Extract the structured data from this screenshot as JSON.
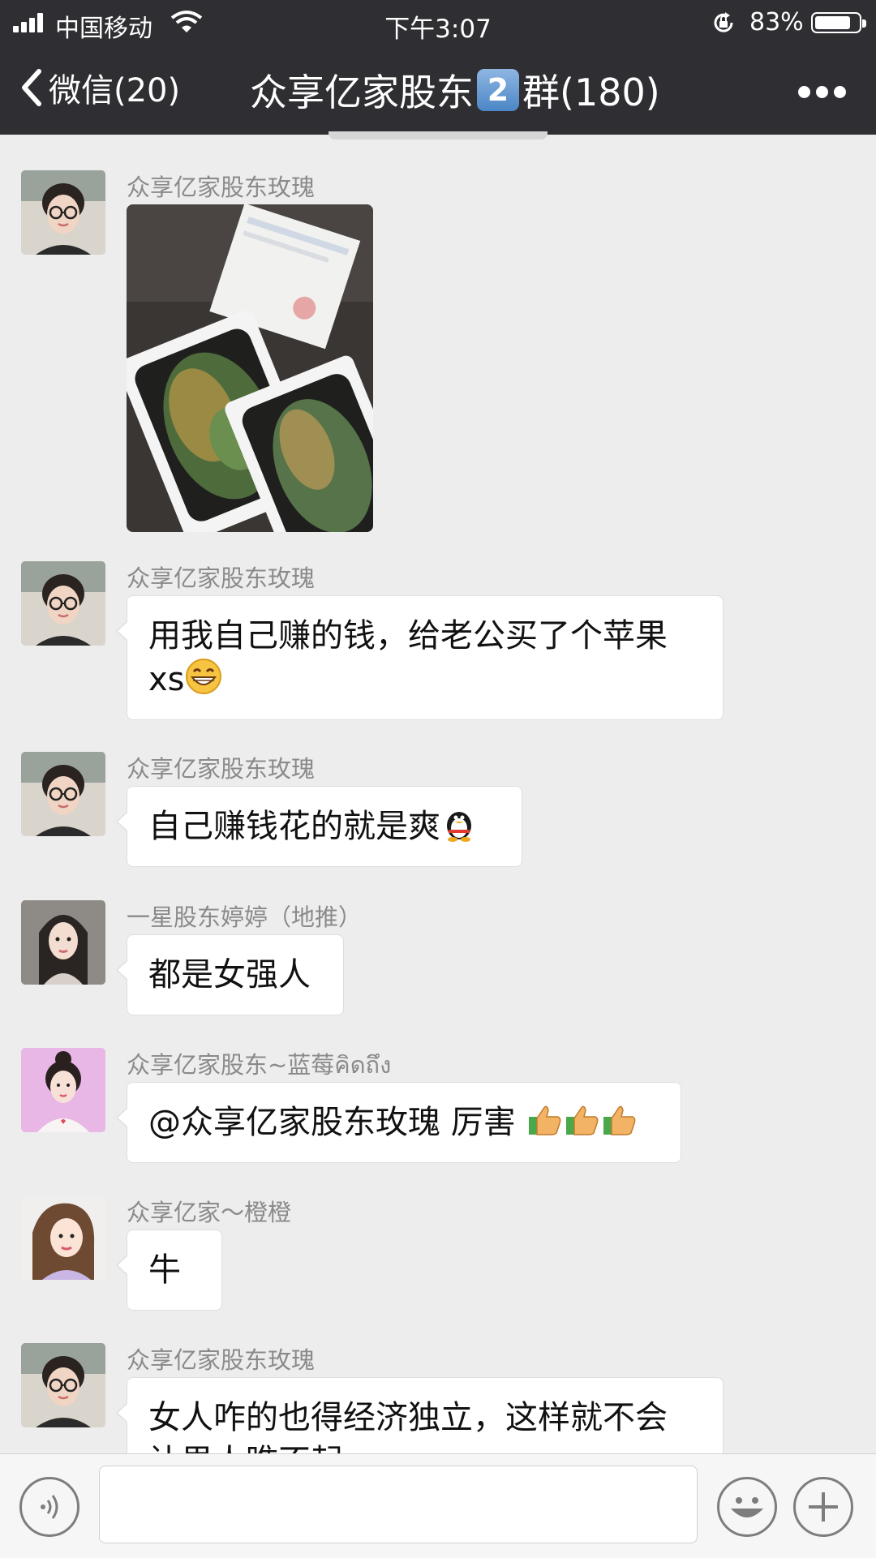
{
  "status_bar": {
    "carrier": "中国移动",
    "time": "下午3:07",
    "battery_percent_label": "83%",
    "battery_level": 0.83
  },
  "nav": {
    "back_label": "微信(20)",
    "title_prefix": "众享亿家股东",
    "title_keycap": "2",
    "title_suffix": "群(180)"
  },
  "messages": [
    {
      "sender": "众享亿家股东玫瑰",
      "type": "image",
      "image_desc": "iPhone XS boxes"
    },
    {
      "sender": "众享亿家股东玫瑰",
      "line1": "用我自己赚的钱，给老公买了个苹果",
      "line2": "xs",
      "emoji": "grin-emoji"
    },
    {
      "sender": "众享亿家股东玫瑰",
      "text": "自己赚钱花的就是爽",
      "emoji": "penguin-emoji"
    },
    {
      "sender": "一星股东婷婷（地推）",
      "text": "都是女强人"
    },
    {
      "sender": "众享亿家股东~蓝莓คิดถึง",
      "text": "@众享亿家股东玫瑰 厉害",
      "emoji": "thumbs-up-emoji"
    },
    {
      "sender": "众享亿家～橙橙",
      "text": "牛"
    },
    {
      "sender": "众享亿家股东玫瑰",
      "line1": "女人咋的也得经济独立，这样就不会",
      "line2": "让男人瞧不起"
    }
  ],
  "input": {
    "placeholder": ""
  },
  "colors": {
    "header_bg": "#2f2f33",
    "chat_bg": "#ededed",
    "bubble_bg": "#ffffff",
    "sender_text": "#8a8a8a"
  }
}
